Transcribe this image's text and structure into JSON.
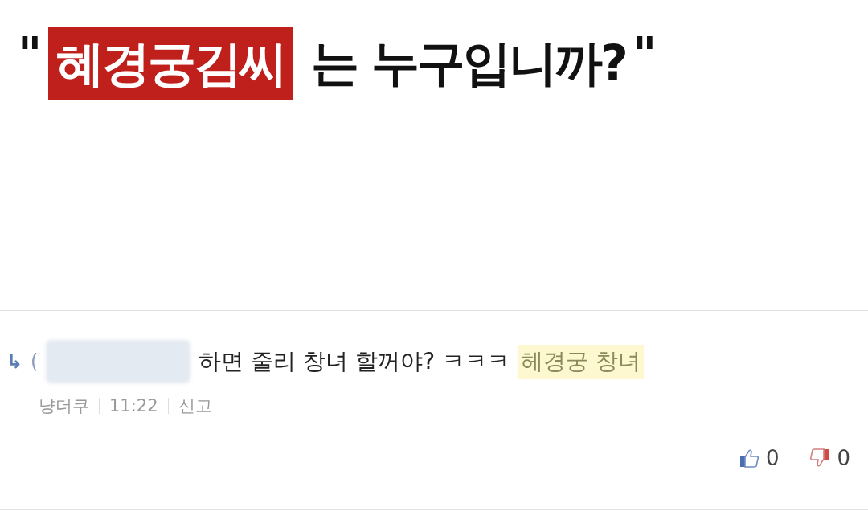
{
  "headline": {
    "open_quote": "\"",
    "highlight": "혜경궁김씨",
    "rest": "는 누구입니까?",
    "close_quote": "\""
  },
  "comment": {
    "reply_marker": "↳",
    "paren": "(",
    "text": "하면 줄리 창녀 할꺼야? ㅋㅋㅋ",
    "highlighted": "헤경궁 창녀",
    "author": "냥더쿠",
    "time": "11:22",
    "report": "신고",
    "likes": "0",
    "dislikes": "0"
  }
}
